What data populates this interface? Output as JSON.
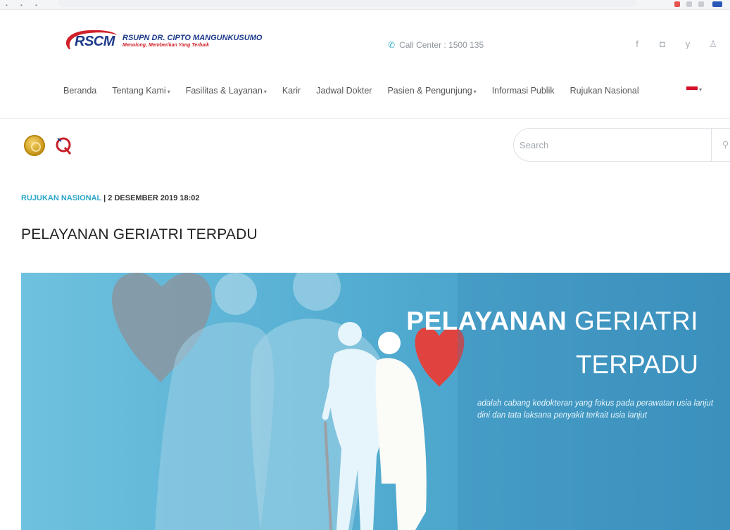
{
  "header": {
    "logo": {
      "mark": "RSCM",
      "name": "RSUPN DR. CIPTO MANGUNKUSUMO",
      "tagline": "Menolong, Memberikan Yang Terbaik"
    },
    "call_center": "Call Center : 1500 135",
    "social": [
      {
        "icon": "facebook-icon",
        "glyph": "f"
      },
      {
        "icon": "instagram-icon",
        "glyph": "◘"
      },
      {
        "icon": "twitter-icon",
        "glyph": "y"
      },
      {
        "icon": "youtube-icon",
        "glyph": "♙"
      }
    ]
  },
  "nav": {
    "items": [
      {
        "label": "Beranda",
        "dropdown": false
      },
      {
        "label": "Tentang Kami",
        "dropdown": true
      },
      {
        "label": "Fasilitas & Layanan",
        "dropdown": true
      },
      {
        "label": "Karir",
        "dropdown": false
      },
      {
        "label": "Jadwal Dokter",
        "dropdown": false
      },
      {
        "label": "Pasien & Pengunjung",
        "dropdown": true
      },
      {
        "label": "Informasi Publik",
        "dropdown": false
      },
      {
        "label": "Rujukan Nasional",
        "dropdown": false
      }
    ],
    "language_caret": "▾",
    "flag_colors": [
      "#d7102a",
      "#ffffff"
    ]
  },
  "search": {
    "placeholder": "Search",
    "button_icon": "search-icon"
  },
  "article": {
    "category": "RUJUKAN NASIONAL",
    "date": "| 2 DESEMBER 2019 18:02",
    "title": "PELAYANAN GERIATRI TERPADU"
  },
  "banner": {
    "title_bold": "PELAYANAN",
    "title_light": "GERIATRI",
    "title_line2": "TERPADU",
    "subtitle": "adalah cabang kedokteran yang fokus pada perawatan usia lanjut dini dan tata laksana penyakit terkait usia lanjut"
  },
  "colors": {
    "accent": "#2ba6c7",
    "brand_blue": "#1d3a8a",
    "brand_red": "#d0202a",
    "banner_heart_red": "#e0433f"
  }
}
